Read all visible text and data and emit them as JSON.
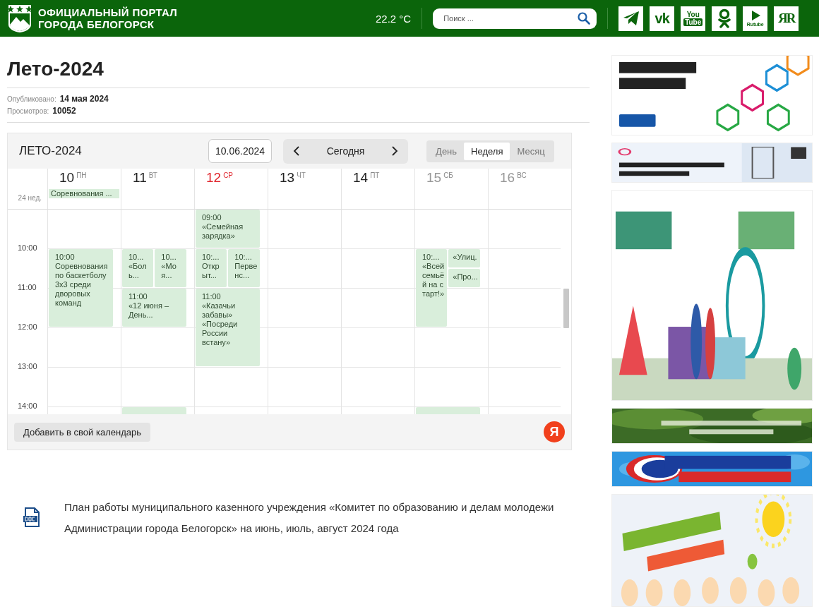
{
  "header": {
    "site_title": [
      "ОФИЦИАЛЬНЫЙ ПОРТАЛ",
      "ГОРОДА БЕЛОГОРСК"
    ],
    "temperature": "22.2 °C",
    "search": {
      "placeholder": "Поиск ..."
    },
    "social": [
      {
        "kind": "telegram"
      },
      {
        "kind": "vk",
        "label": "vk"
      },
      {
        "kind": "youtube",
        "label": [
          "You",
          "Tube"
        ]
      },
      {
        "kind": "ok"
      },
      {
        "kind": "rutube",
        "label": "Rutube"
      },
      {
        "kind": "yar",
        "label": "ЯR"
      }
    ]
  },
  "article": {
    "title": "Лето-2024",
    "meta": [
      {
        "label": "Опубликовано:",
        "value": "14 мая 2024"
      },
      {
        "label": "Просмотров:",
        "value": "10052"
      }
    ]
  },
  "calendar": {
    "title": "ЛЕТО-2024",
    "date": "10.06.2024",
    "today_button": "Сегодня",
    "views": [
      {
        "label": "День",
        "selected": false
      },
      {
        "label": "Неделя",
        "selected": true
      },
      {
        "label": "Месяц",
        "selected": false
      }
    ],
    "week_label": "24 нед.",
    "hours": [
      "10:00",
      "11:00",
      "12:00",
      "13:00",
      "14:00"
    ],
    "days": [
      {
        "number": "10",
        "weekday": "ПН",
        "today": false,
        "weekend": false,
        "all_day": [
          "Соревнования ..."
        ],
        "slots": [
          {
            "kind": "free"
          },
          {
            "kind": "two_hours",
            "time": "10:00",
            "title": "Соревнования по баскетболу 3х3 среди дворовых команд"
          }
        ]
      },
      {
        "number": "11",
        "weekday": "ВТ",
        "today": false,
        "weekend": false,
        "slots": [
          {
            "kind": "free"
          },
          {
            "kind": "split",
            "lanes": [
              [
                {
                  "kind": "hour",
                  "time": "10...",
                  "title": "«Боль..."
                }
              ],
              [
                {
                  "kind": "hour",
                  "time": "10...",
                  "title": "«Моя..."
                }
              ]
            ]
          },
          {
            "kind": "hour",
            "time": "11:00",
            "title": "«12 июня – День..."
          },
          {
            "kind": "free"
          },
          {
            "kind": "free"
          },
          {
            "kind": "hour"
          }
        ]
      },
      {
        "number": "12",
        "weekday": "СР",
        "today": true,
        "weekend": false,
        "slots": [
          {
            "kind": "hour",
            "time": "09:00",
            "title": "«Семейная зарядка»"
          },
          {
            "kind": "split",
            "lanes": [
              [
                {
                  "kind": "hour",
                  "time": "10:...",
                  "title": "Открыт..."
                }
              ],
              [
                {
                  "kind": "hour",
                  "time": "10:...",
                  "title": "Первенс..."
                }
              ]
            ]
          },
          {
            "kind": "two_hours",
            "time": "11:00",
            "title": "«Казачьи забавы» «Посреди России встану»"
          }
        ]
      },
      {
        "number": "13",
        "weekday": "ЧТ",
        "today": false,
        "weekend": false
      },
      {
        "number": "14",
        "weekday": "ПТ",
        "today": false,
        "weekend": false
      },
      {
        "number": "15",
        "weekday": "СБ",
        "today": false,
        "weekend": true,
        "slots": [
          {
            "kind": "free"
          },
          {
            "kind": "split",
            "lanes": [
              [
                {
                  "kind": "two_hours",
                  "time": "10:...",
                  "title": "«Всей семьёй на старт!»"
                }
              ],
              [
                {
                  "kind": "half",
                  "title": "«Улиц."
                },
                {
                  "kind": "half",
                  "title": "«Про..."
                }
              ]
            ]
          },
          {
            "kind": "free"
          },
          {
            "kind": "free"
          },
          {
            "kind": "hour"
          }
        ]
      },
      {
        "number": "16",
        "weekday": "ВС",
        "today": false,
        "weekend": true
      }
    ],
    "add_button": "Добавить в свой календарь",
    "yandex_logo": "Я"
  },
  "document": {
    "kind": "doc",
    "text": "План работы муниципального казенного учреждения «Комитет по образованию и делам молодежи Администрации города Белогорск» на июнь, июль, август 2024 года"
  }
}
